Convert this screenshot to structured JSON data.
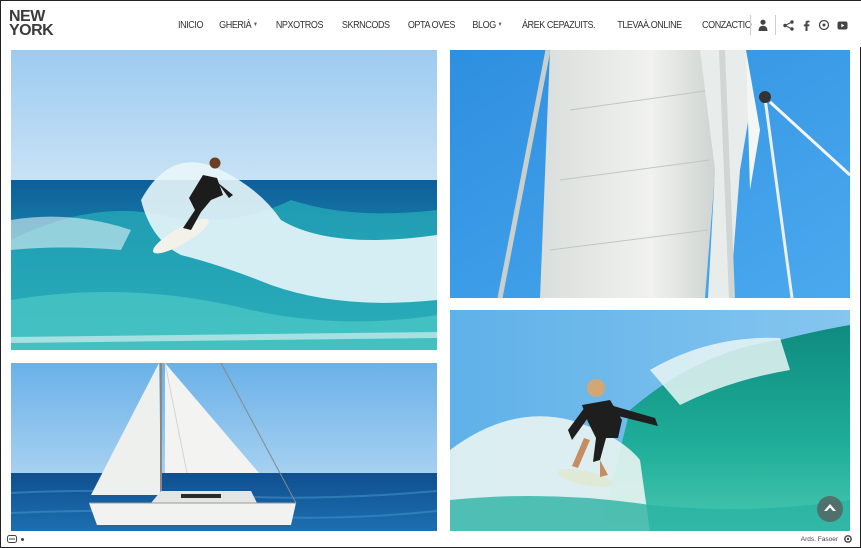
{
  "brand": {
    "line1": "NEW",
    "line2": "YORK"
  },
  "nav": {
    "items": [
      {
        "label": "INICIO",
        "has_caret": false
      },
      {
        "label": "GHERIÀ",
        "has_caret": true
      },
      {
        "label": "NPXOTROS",
        "has_caret": false
      },
      {
        "label": "SKRNCODS",
        "has_caret": false
      },
      {
        "label": "OPTA OVES",
        "has_caret": false
      },
      {
        "label": "BLOG",
        "has_caret": true
      },
      {
        "label": "ÁREK CEPAZUITS.",
        "has_caret": false
      },
      {
        "label": "TLEVAÀ.ONLINE",
        "has_caret": false
      },
      {
        "label": "CONZACTIO",
        "has_caret": false
      }
    ],
    "tools": [
      "user-icon",
      "share-icon",
      "facebook-icon",
      "pinterest-icon",
      "youtube-icon"
    ]
  },
  "gallery": {
    "tiles": [
      {
        "name": "surfer-wave-photo",
        "subject": "surfer riding wave"
      },
      {
        "name": "sail-mast-photo",
        "subject": "sailboat sail and mast against sky"
      },
      {
        "name": "sailboat-photo",
        "subject": "white sailboat on sea"
      },
      {
        "name": "boy-surfer-photo",
        "subject": "young surfer on green wave"
      }
    ]
  },
  "footer": {
    "credit": "Ards. Fasoer"
  },
  "colors": {
    "sky": "#8fc6ef",
    "sea": "#1f7fb8",
    "wave": "#2fb3b5",
    "text": "#333333"
  }
}
